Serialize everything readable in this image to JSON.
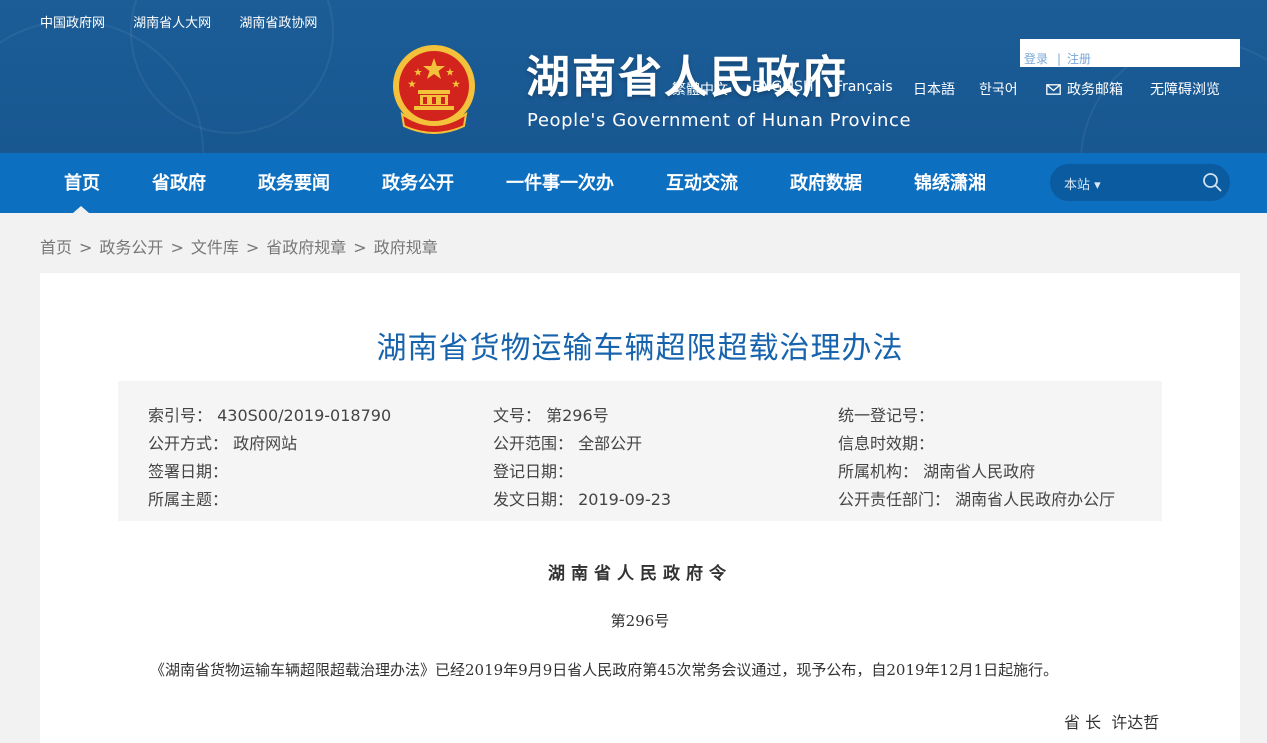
{
  "top_links": [
    "中国政府网",
    "湖南省人大网",
    "湖南省政协网"
  ],
  "site": {
    "title": "湖南省人民政府",
    "subtitle": "People's Government of Hunan Province"
  },
  "account": {
    "login": "登录",
    "divider": "|",
    "register": "注册"
  },
  "languages": {
    "traditional": "繁體中文",
    "english": "ENGLISH",
    "french": "Français",
    "japanese": "日本語",
    "korean": "한국어",
    "mailbox": "政务邮箱",
    "accessibility": "无障碍浏览"
  },
  "nav": {
    "items": [
      "首页",
      "省政府",
      "政务要闻",
      "政务公开",
      "一件事一次办",
      "互动交流",
      "政府数据",
      "锦绣潇湘"
    ],
    "active_index": 0
  },
  "search": {
    "scope": "本站 ▾",
    "placeholder": ""
  },
  "breadcrumb": [
    "首页",
    "政务公开",
    "文件库",
    "省政府规章",
    "政府规章"
  ],
  "article": {
    "title": "湖南省货物运输车辆超限超载治理办法",
    "meta": {
      "index_no_label": "索引号：",
      "index_no": "430S00/2019-018790",
      "doc_no_label": "文号：",
      "doc_no": "第296号",
      "unified_reg_label": "统一登记号：",
      "unified_reg": "",
      "disclosure_mode_label": "公开方式：",
      "disclosure_mode": "政府网站",
      "disclosure_scope_label": "公开范围：",
      "disclosure_scope": "全部公开",
      "validity_label": "信息时效期：",
      "validity": "",
      "sign_date_label": "签署日期：",
      "sign_date": "",
      "reg_date_label": "登记日期：",
      "reg_date": "",
      "org_label": "所属机构：",
      "org": "湖南省人民政府",
      "topic_label": "所属主题：",
      "topic": "",
      "issue_date_label": "发文日期：",
      "issue_date": "2019-09-23",
      "dept_label": "公开责任部门：",
      "dept": "湖南省人民政府办公厅"
    },
    "decree_org": "湖南省人民政府令",
    "decree_no": "第296号",
    "body": "《湖南省货物运输车辆超限超载治理办法》已经2019年9月9日省人民政府第45次常务会议通过，现予公布，自2019年12月1日起施行。",
    "signatory_title": "省 长",
    "signatory": "许达哲"
  },
  "colors": {
    "header_bg": "#1a5a94",
    "nav_bg": "#0d6fc0",
    "title_blue": "#1763ad",
    "emblem_red": "#d2231d",
    "emblem_gold": "#f4c23a"
  }
}
